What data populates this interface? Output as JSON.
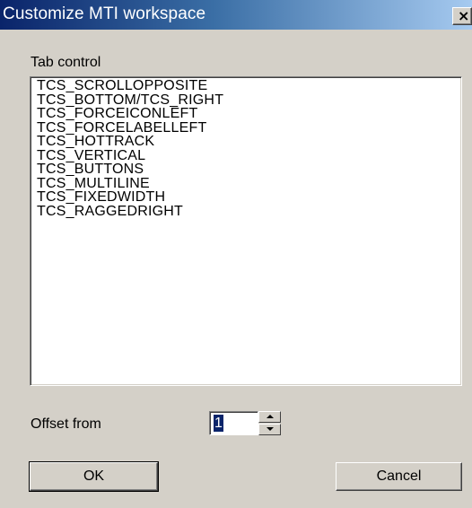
{
  "window": {
    "title": "Customize MTI workspace",
    "close_icon": "close-icon",
    "close_glyph": "×"
  },
  "tab_control": {
    "label": "Tab control",
    "items": [
      "TCS_SCROLLOPPOSITE",
      "TCS_BOTTOM/TCS_RIGHT",
      "TCS_FORCEICONLEFT",
      "TCS_FORCELABELLEFT",
      "TCS_HOTTRACK",
      "TCS_VERTICAL",
      "TCS_BUTTONS",
      "TCS_MULTILINE",
      "TCS_FIXEDWIDTH",
      "TCS_RAGGEDRIGHT"
    ]
  },
  "offset": {
    "label": "Offset from",
    "value": "1",
    "up_icon": "spin-up-icon",
    "down_icon": "spin-down-icon"
  },
  "buttons": {
    "ok_label": "OK",
    "cancel_label": "Cancel"
  },
  "colors": {
    "dialog_face": "#d4d0c8",
    "title_active": "#0a246a",
    "title_gradient_end": "#a6caf0",
    "selection": "#0a246a"
  }
}
